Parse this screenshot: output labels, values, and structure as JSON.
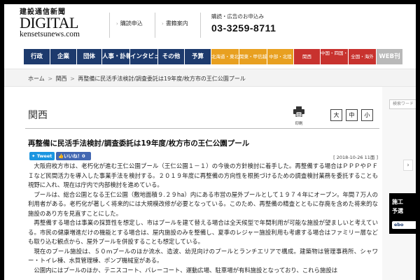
{
  "logo": {
    "japanese": "建設通信新聞",
    "digital": "DIGITAL",
    "url": "kensetsunews.com"
  },
  "header": {
    "links": [
      "購読申込",
      "書籍案内"
    ],
    "contact_label": "購読・広告のお申込み",
    "phone": "03-3259-8711"
  },
  "nav": {
    "items": [
      {
        "label": "行政",
        "style": "blue"
      },
      {
        "label": "企業",
        "style": "blue"
      },
      {
        "label": "団体",
        "style": "blue"
      },
      {
        "label": "人事・訃報",
        "style": "blue"
      },
      {
        "label": "インタビュー",
        "style": "blue"
      },
      {
        "label": "その他",
        "style": "blue"
      },
      {
        "label": "予算",
        "style": "blue"
      },
      {
        "label": "北海道・東北",
        "style": "orange"
      },
      {
        "label": "関東・甲信越",
        "style": "orange"
      },
      {
        "label": "中部・北陸",
        "style": "orange"
      },
      {
        "label": "関西",
        "style": "red"
      },
      {
        "label": "中国・四国・九州",
        "style": "red"
      },
      {
        "label": "全国・海外",
        "style": "red"
      },
      {
        "label": "WEB刊",
        "style": "gray"
      }
    ]
  },
  "breadcrumb": {
    "items": [
      "ホーム",
      "関西",
      "再整備に民活手法検討/調査委託は19年度/枚方市の王仁公園プール"
    ],
    "separator": ">"
  },
  "article": {
    "section": "関西",
    "print_label": "印刷",
    "font_sizes": [
      "大",
      "中",
      "小"
    ],
    "headline": "再整備に民活手法検討/調査委託は19年度/枚方市の王仁公園プール",
    "tweet_label": "Tweet",
    "like_label": "いいね！0",
    "meta": "[ 2018-10-26  11面 ]",
    "paragraphs": [
      "大阪府枚方市は、老朽化が進む王仁公園プール（王仁公園１－１）の今後の方針検討に着手した。再整備する場合はＰＰＰやＰＦＩなど民間活力を導入した事業手法を検討する。２０１９年度に再整備の方向性を根拠づけるための調査検討業務を委託することも視野に入れ、現在は庁内で内部検討を進めている。",
      "プールは、総合公園となる王仁公園（敷地面積９.２９ha）内にある市営の屋外プールとして１９７４年にオープン。年間７万人の利用者がある。老朽化が著しく将来的には大規模改修が必要となっている。このため、再整備の精査とともに存廃を含めた将来的な施設のあり方を見直すことにした。",
      "再整備する場合は事業の採算性を想定し、市はプールを建て替える場合は全天候型で年間利用が可能な施設が望ましいと考えている。市民の健康増進だけの機能とする場合は、屋内施設のみを整備し、夏季のレジャー施設利用も考慮する場合はファミリー層なども取り込む観点から、屋外プールを併設することも想定している。",
      "現在のプール施設は、５０ｍプールのほか流水、造波、幼児向けのプールとランチエリアで構成。建築物は管理事務所、シャワー・トイレ棟、水質管理棟、ポンプ機械室がある。",
      "公園内にはプールのほか、テニスコート、バレーコート、運動広場、駐車場が有料施設となっており、これら施設は"
    ]
  },
  "sidebar": {
    "search_placeholder": "検索ワード",
    "ad_line1": "施工",
    "ad_line2": "予選",
    "ad_button": "ebo"
  },
  "colors": {
    "nav_blue": "#1d3a6d",
    "nav_orange": "#e8a020",
    "nav_red": "#c8322e",
    "nav_gray": "#b9b9b9",
    "tweet": "#1b95e0",
    "like": "#4267b2"
  }
}
